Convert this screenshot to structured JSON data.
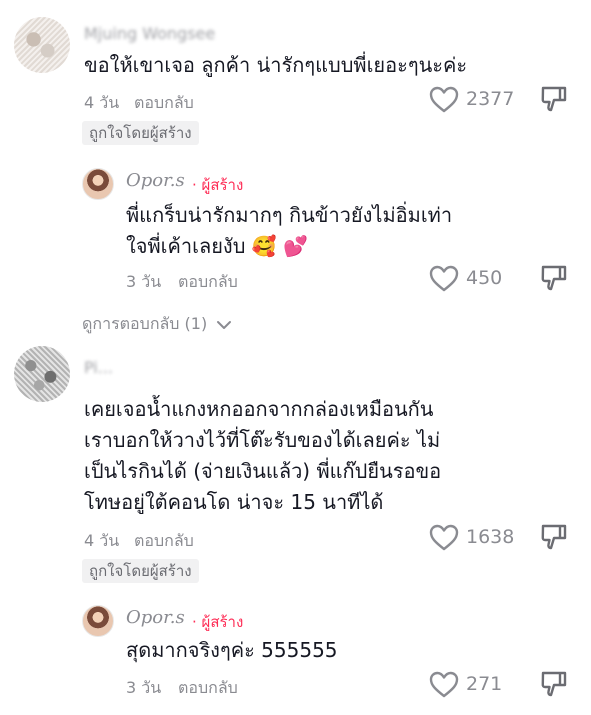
{
  "comments": [
    {
      "username": "Mjuing Wongsee",
      "text_lines": [
        "ขอให้เขาเจอ ลูกค้า น่ารักๆแบบพี่เยอะๆนะค่ะ"
      ],
      "time": "4 วัน",
      "reply_label": "ตอบกลับ",
      "likes": "2377",
      "liked_by_creator": "ถูกใจโดยผู้สร้าง",
      "reply": {
        "username": "Opor.s",
        "creator_tag": "· ผู้สร้าง",
        "text_lines": [
          "พี่แกร็บน่ารักมากๆ กินข้าวยังไม่อิ่มเท่า",
          "ใจพี่เค้าเลยงับ"
        ],
        "emojis": "🥰 💕",
        "time": "3 วัน",
        "reply_label": "ตอบกลับ",
        "likes": "450"
      },
      "view_replies": "ดูการตอบกลับ (1)"
    },
    {
      "username": "Pi...",
      "text_lines": [
        "เคยเจอน้ำแกงหกออกจากกล่องเหมือนกัน",
        "เราบอกให้วางไว้ที่โต๊ะรับของได้เลยค่ะ ไม่",
        "เป็นไรกินได้ (จ่ายเงินแล้ว) พี่แก๊ปยืนรอขอ",
        "โทษอยู่ใต้คอนโด น่าจะ 15 นาทีได้"
      ],
      "time": "4 วัน",
      "reply_label": "ตอบกลับ",
      "likes": "1638",
      "liked_by_creator": "ถูกใจโดยผู้สร้าง",
      "reply": {
        "username": "Opor.s",
        "creator_tag": "· ผู้สร้าง",
        "text_lines": [
          "สุดมากจริงๆค่ะ 555555"
        ],
        "time": "3 วัน",
        "reply_label": "ตอบกลับ",
        "likes": "271"
      }
    }
  ],
  "icons": {
    "like": "heart-outline-icon",
    "dislike": "thumbs-down-outline-icon",
    "expand": "chevron-down-icon"
  },
  "colors": {
    "text": "#161823",
    "muted": "#8a8b91",
    "creator": "#fe2c55",
    "badge_bg": "#f1f1f2"
  }
}
